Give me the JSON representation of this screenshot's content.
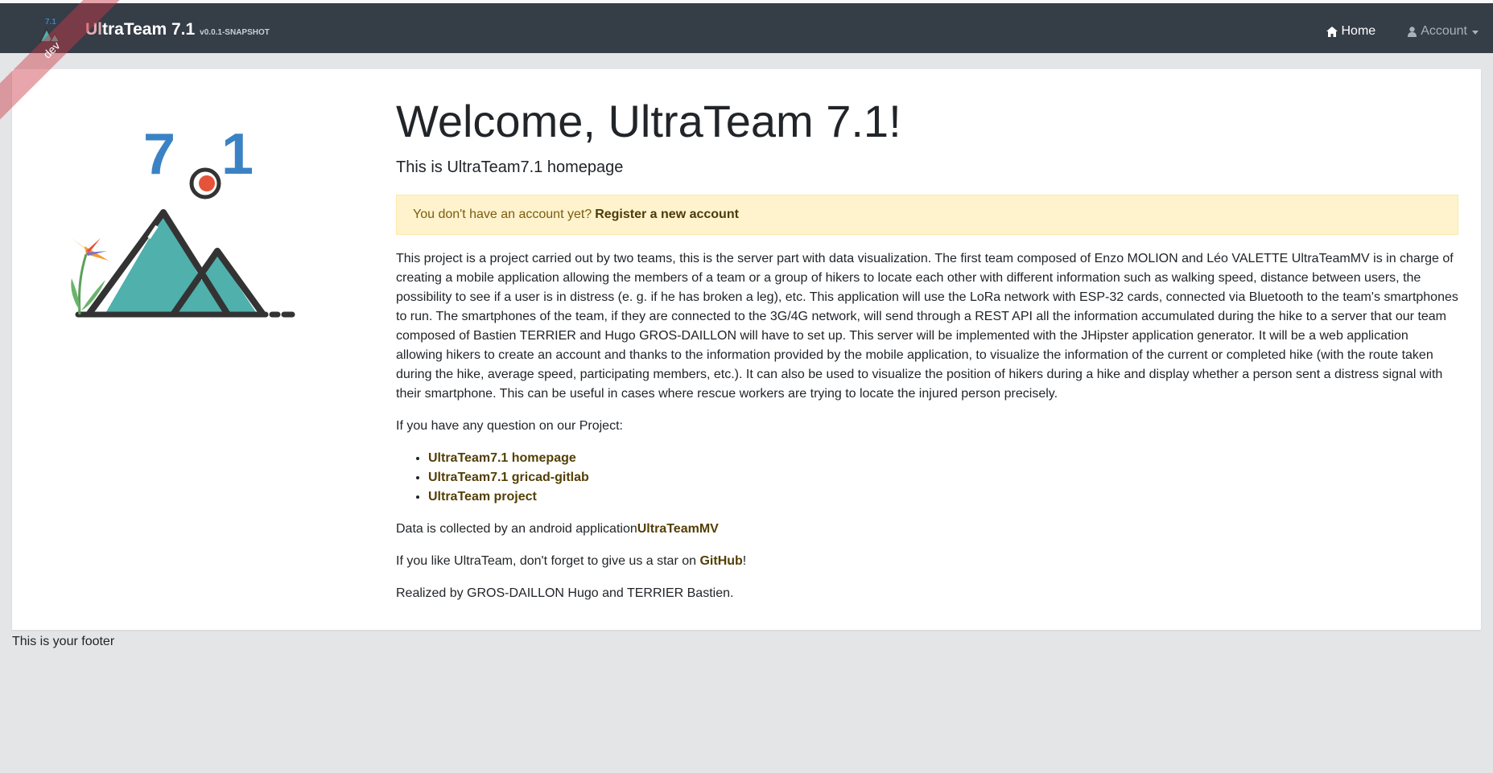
{
  "navbar": {
    "brand_first": "Ul",
    "brand_rest": "traTeam 7.1",
    "version": "v0.0.1-SNAPSHOT",
    "ribbon": "dev",
    "home_label": "Home",
    "account_label": "Account"
  },
  "main": {
    "title": "Welcome, UltraTeam 7.1!",
    "lead": "This is UltraTeam7.1 homepage",
    "alert": {
      "text": "You don't have an account yet?",
      "link": "Register a new account"
    },
    "description": "This project is a project carried out by two teams, this is the server part with data visualization. The first team composed of Enzo MOLION and Léo VALETTE UltraTeamMV is in charge of creating a mobile application allowing the members of a team or a group of hikers to locate each other with different information such as walking speed, distance between users, the possibility to see if a user is in distress (e. g. if he has broken a leg), etc. This application will use the LoRa network with ESP-32 cards, connected via Bluetooth to the team's smartphones to run. The smartphones of the team, if they are connected to the 3G/4G network, will send through a REST API all the information accumulated during the hike to a server that our team composed of Bastien TERRIER and Hugo GROS-DAILLON will have to set up. This server will be implemented with the JHipster application generator. It will be a web application allowing hikers to create an account and thanks to the information provided by the mobile application, to visualize the information of the current or completed hike (with the route taken during the hike, average speed, participating members, etc.). It can also be used to visualize the position of hikers during a hike and display whether a person sent a distress signal with their smartphone. This can be useful in cases where rescue workers are trying to locate the injured person precisely.",
    "question": "If you have any question on our Project:",
    "links": [
      "UltraTeam7.1 homepage",
      "UltraTeam7.1 gricad-gitlab",
      "UltraTeam project"
    ],
    "data_text": "Data is collected by an android application",
    "data_link": "UltraTeamMV",
    "star_text": "If you like UltraTeam, don't forget to give us a star on ",
    "star_link": "GitHub",
    "star_end": "!",
    "realized": "Realized by GROS-DAILLON Hugo and TERRIER Bastien.",
    "logo_digit_left": "7",
    "logo_digit_right": "1"
  },
  "footer": {
    "text": "This is your footer"
  },
  "colors": {
    "navbar": "#353d47",
    "logo_blue": "#3b82c4",
    "logo_teal": "#4fb0ac",
    "logo_red": "#e5533b",
    "alert_bg": "#fef3cc",
    "link": "#533f05"
  }
}
